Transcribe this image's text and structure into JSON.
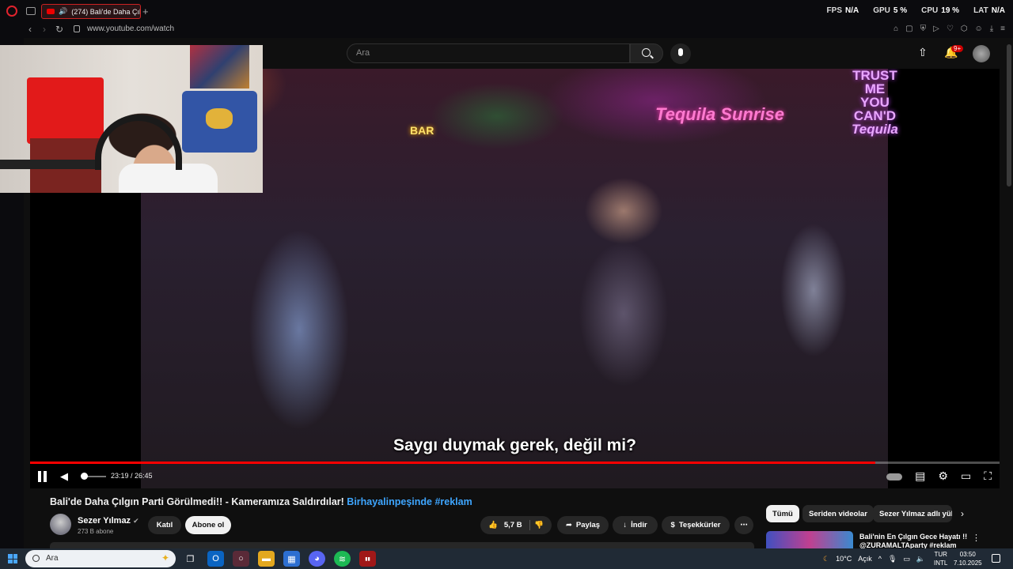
{
  "browser": {
    "tab_title": "(274) Bali'de Daha Çıl",
    "url": "www.youtube.com/watch",
    "stats": [
      {
        "label": "FPS",
        "value": "N/A"
      },
      {
        "label": "GPU",
        "value": "5 %"
      },
      {
        "label": "CPU",
        "value": "19 %"
      },
      {
        "label": "LAT",
        "value": "N/A"
      }
    ]
  },
  "header": {
    "search_placeholder": "Ara",
    "notification_count": "9+"
  },
  "video": {
    "subtitle": "Saygı duymak gerek, değil mi?",
    "neon_sign_1": "Tequila Sunrise",
    "neon_sign_2a": "TRUST ME",
    "neon_sign_2b": "YOU CAN'D",
    "neon_sign_2c": "Tequila",
    "neon_sign_3": "BAR",
    "current_time": "23:19",
    "duration": "26:45",
    "time_display": "23:19 / 26:45",
    "progress_fraction": 0.872,
    "volume_fraction": 0.0
  },
  "details": {
    "title": "Bali'de Daha Çılgın Parti Görülmedi!! - Kameramıza Saldırdılar!",
    "hashtags": "Birhayalinpeşinde #reklam",
    "channel_name": "Sezer Yılmaz",
    "subscribers": "273 B abone",
    "join_label": "Katıl",
    "subscribe_label": "Abone ol",
    "likes": "5,7 B",
    "share_label": "Paylaş",
    "download_label": "İndir",
    "thanks_label": "Teşekkürler"
  },
  "sidebar": {
    "chips": [
      "Tümü",
      "Seriden videolar",
      "Sezer Yılmaz adlı yük"
    ],
    "rec_title": "Bali'nin En Çılgın Gece Hayatı !! @ZURAMALTAparty #reklam"
  },
  "taskbar": {
    "search_placeholder": "Ara",
    "weather": "10°C",
    "weather_desc": "Açık",
    "lang_1": "TUR",
    "lang_2": "INTL",
    "time": "03:50",
    "date": "7.10.2025"
  },
  "colors": {
    "accent": "#ff0000",
    "link": "#3ea6ff",
    "background": "#0f0f0f"
  }
}
